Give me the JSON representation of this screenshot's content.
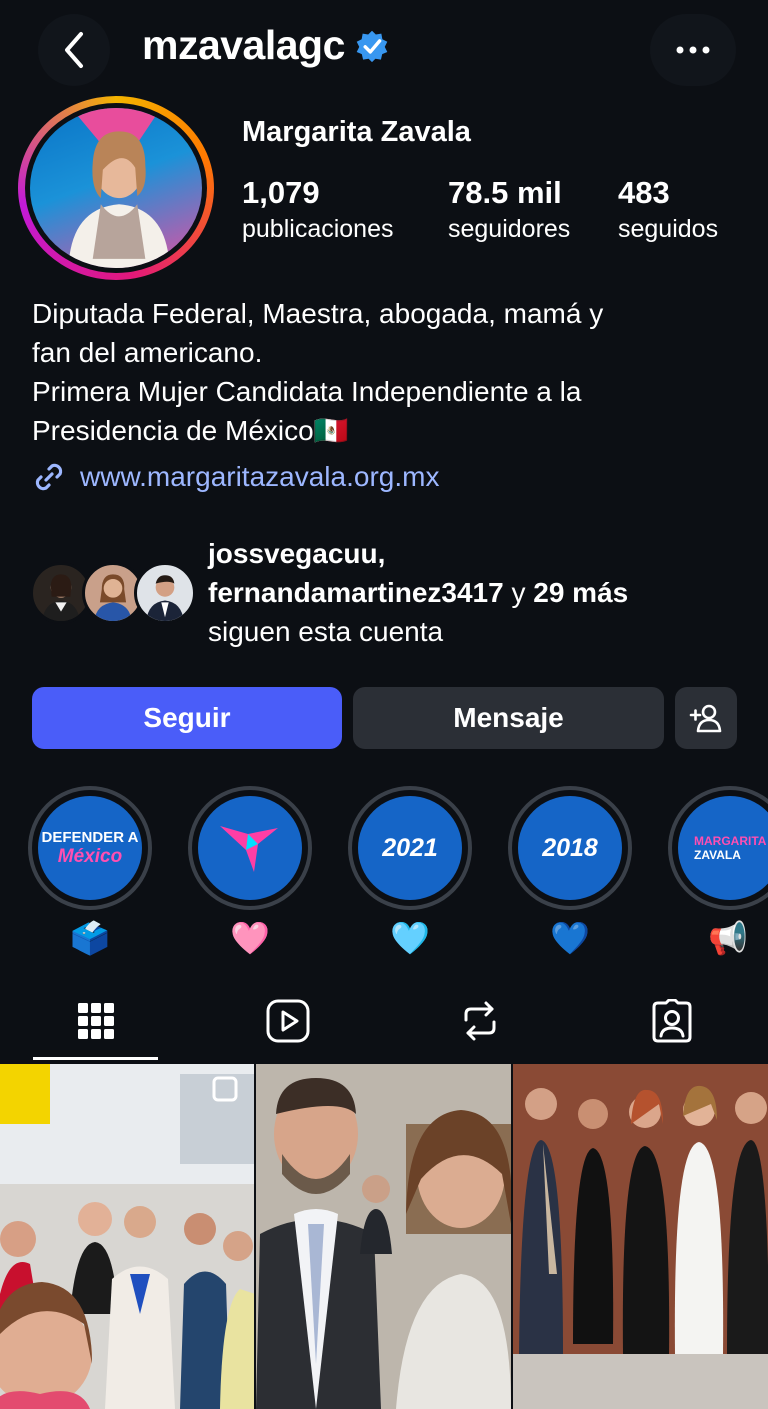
{
  "header": {
    "username": "mzavalagc",
    "back_icon": "chevron-left-icon",
    "verified_icon": "verified-badge-icon",
    "more_icon": "more-horizontal-icon"
  },
  "profile": {
    "name": "Margarita Zavala",
    "stats": [
      {
        "value": "1,079",
        "label": "publicaciones"
      },
      {
        "value": "78.5 mil",
        "label": "seguidores"
      },
      {
        "value": "483",
        "label": "seguidos"
      }
    ],
    "bio_lines": [
      "Diputada Federal, Maestra, abogada, mamá y",
      "fan del americano.",
      "Primera Mujer Candidata Independiente a la",
      "Presidencia de México🇲🇽"
    ],
    "link": "www.margaritazavala.org.mx"
  },
  "followed_by": {
    "name1": "jossvegacuu,",
    "name2": "fernandamartinez3417",
    "connector": " y ",
    "more": "29 más",
    "suffix": "siguen esta cuenta"
  },
  "actions": {
    "follow_label": "Seguir",
    "message_label": "Mensaje",
    "add_user_icon": "add-person-icon"
  },
  "highlights": [
    {
      "text_line1": "DEFENDER A",
      "text_line2": "México",
      "emoji": "🗳️"
    },
    {
      "text": "",
      "emoji": "🩷"
    },
    {
      "text": "2021",
      "emoji": "🩵"
    },
    {
      "text": "2018",
      "emoji": "💙"
    },
    {
      "text_line1": "MARGARITA",
      "text_line2": "ZAVALA",
      "emoji": "📢"
    }
  ],
  "tabs": [
    {
      "icon": "grid-icon",
      "active": true
    },
    {
      "icon": "reels-icon",
      "active": false
    },
    {
      "icon": "reposts-icon",
      "active": false
    },
    {
      "icon": "tagged-icon",
      "active": false
    }
  ],
  "colors": {
    "background": "#0c0f14",
    "follow_button": "#4a5df9",
    "secondary_button": "#2b2f36",
    "link": "#9db7ff",
    "verified": "#3897f0",
    "highlight_fill": "#1565c7"
  }
}
